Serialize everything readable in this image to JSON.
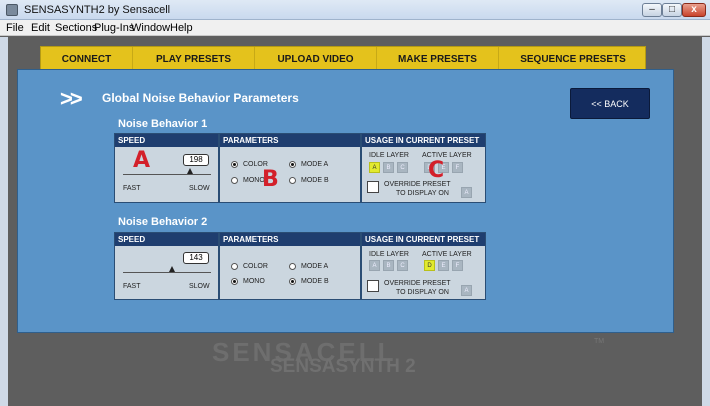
{
  "window": {
    "title": "SENSASYNTH2 by Sensacell",
    "controls": {
      "minimize": "–",
      "maximize": "□",
      "close": "x"
    }
  },
  "menu": [
    "File",
    "Edit",
    "Sections",
    "Plug-Ins",
    "Window",
    "Help"
  ],
  "tabs": [
    "CONNECT",
    "PLAY PRESETS",
    "UPLOAD VIDEO",
    "MAKE PRESETS",
    "SEQUENCE PRESETS"
  ],
  "heading": {
    "arrows": ">>",
    "title": "Global Noise Behavior Parameters"
  },
  "back_button": "<< BACK",
  "headers": {
    "speed": "SPEED",
    "parameters": "PARAMETERS",
    "usage": "USAGE IN CURRENT PRESET"
  },
  "labels": {
    "fast": "FAST",
    "slow": "SLOW",
    "color": "COLOR",
    "mono": "MONO",
    "mode_a": "MODE A",
    "mode_b": "MODE B",
    "idle_layer": "IDLE LAYER",
    "active_layer": "ACTIVE LAYER",
    "override_line1": "OVERRIDE PRESET",
    "override_line2": "TO DISPLAY ON",
    "layer_a": "A",
    "layer_b": "B",
    "layer_c": "C",
    "layer_d": "D",
    "layer_e": "E",
    "layer_f": "F"
  },
  "behaviors": [
    {
      "title": "Noise Behavior 1",
      "speed": "198",
      "color_selected": true,
      "mode_a_selected": true,
      "idle_selected": "A",
      "active_selected": null,
      "override_button": "A"
    },
    {
      "title": "Noise Behavior 2",
      "speed": "143",
      "color_selected": false,
      "mode_a_selected": false,
      "idle_selected": null,
      "active_selected": "D",
      "override_button": "A"
    }
  ],
  "markers": [
    "A",
    "B",
    "C"
  ],
  "watermark": {
    "line1": "SENSACELL",
    "line2": "SENSASYNTH 2",
    "tm": "TM"
  }
}
